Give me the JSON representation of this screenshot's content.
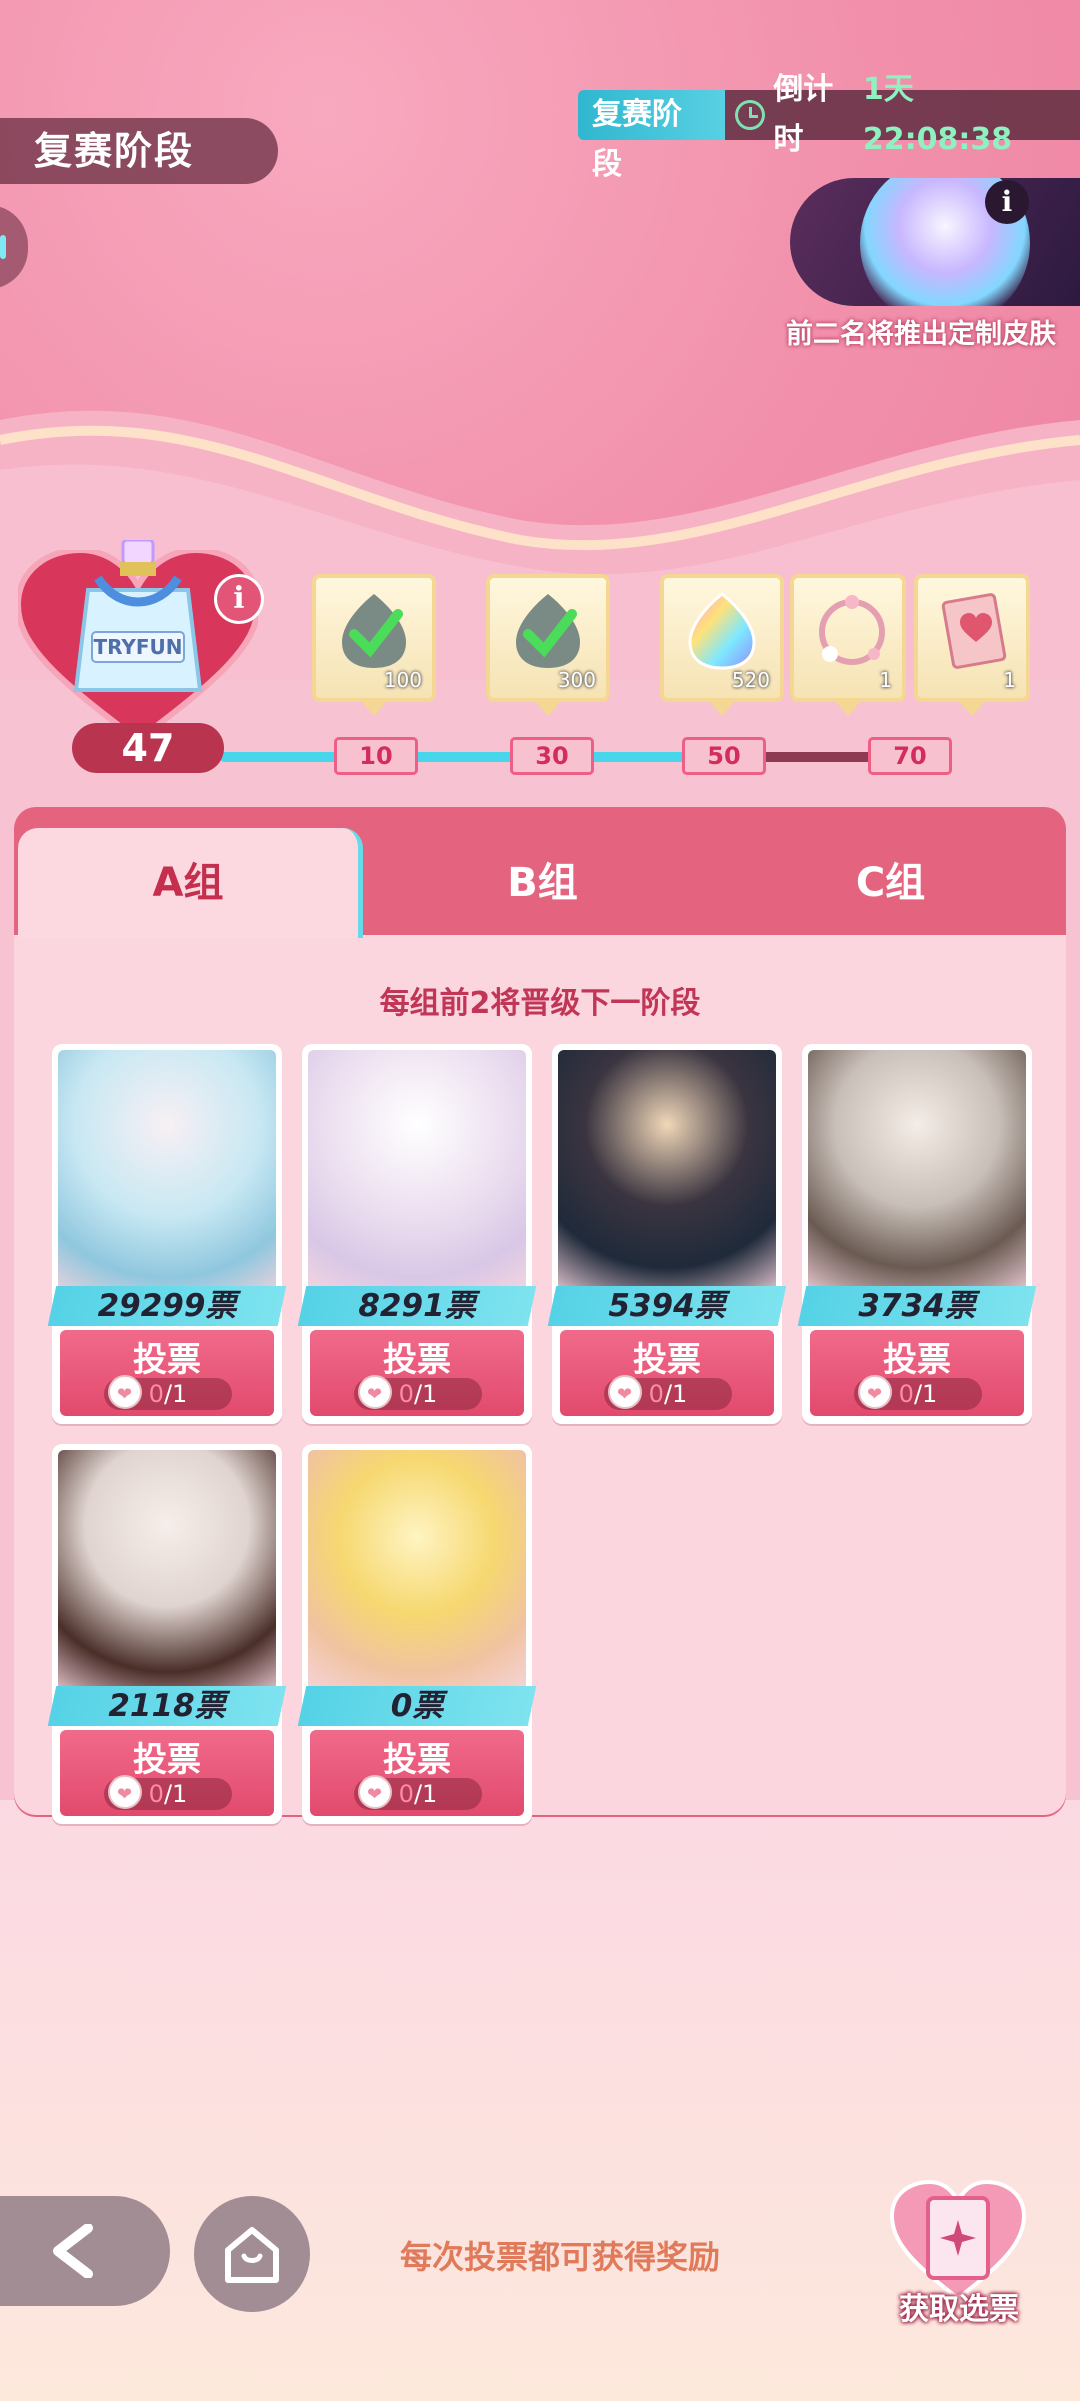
{
  "header": {
    "stage_title": "复赛阶段",
    "timer_phase": "复赛阶段",
    "timer_prefix": "倒计时",
    "timer_value": "1天22:08:38"
  },
  "banner": {
    "caption": "前二名将推出定制皮肤",
    "info_label": "i"
  },
  "progress": {
    "info_label": "i",
    "current": "47",
    "current_value": 47,
    "max_value": 70,
    "milestones": [
      "10",
      "30",
      "50",
      "70"
    ],
    "rewards": [
      {
        "qty": "100",
        "icon": "check-gem-icon",
        "claimed": true
      },
      {
        "qty": "300",
        "icon": "check-gem-icon",
        "claimed": true
      },
      {
        "qty": "520",
        "icon": "rainbow-gem-icon",
        "claimed": false
      },
      {
        "qty": "1",
        "icon": "flower-frame-icon",
        "claimed": false
      },
      {
        "qty": "1",
        "icon": "heart-card-icon",
        "claimed": false
      }
    ]
  },
  "tabs": [
    "A组",
    "B组",
    "C组"
  ],
  "notice": "每组前2将晋级下一阶段",
  "candidates": [
    {
      "votes": "29299票",
      "vote_label": "投票",
      "used": "0",
      "limit": "/1"
    },
    {
      "votes": "8291票",
      "vote_label": "投票",
      "used": "0",
      "limit": "/1"
    },
    {
      "votes": "5394票",
      "vote_label": "投票",
      "used": "0",
      "limit": "/1"
    },
    {
      "votes": "3734票",
      "vote_label": "投票",
      "used": "0",
      "limit": "/1"
    },
    {
      "votes": "2118票",
      "vote_label": "投票",
      "used": "0",
      "limit": "/1"
    },
    {
      "votes": "0票",
      "vote_label": "投票",
      "used": "0",
      "limit": "/1"
    }
  ],
  "footer": {
    "tip": "每次投票都可获得奖励",
    "get_votes_label": "获取选票"
  },
  "colors": {
    "accent": "#e4647f",
    "cyan": "#48d7ea",
    "timer_green": "#8ff0c0"
  }
}
